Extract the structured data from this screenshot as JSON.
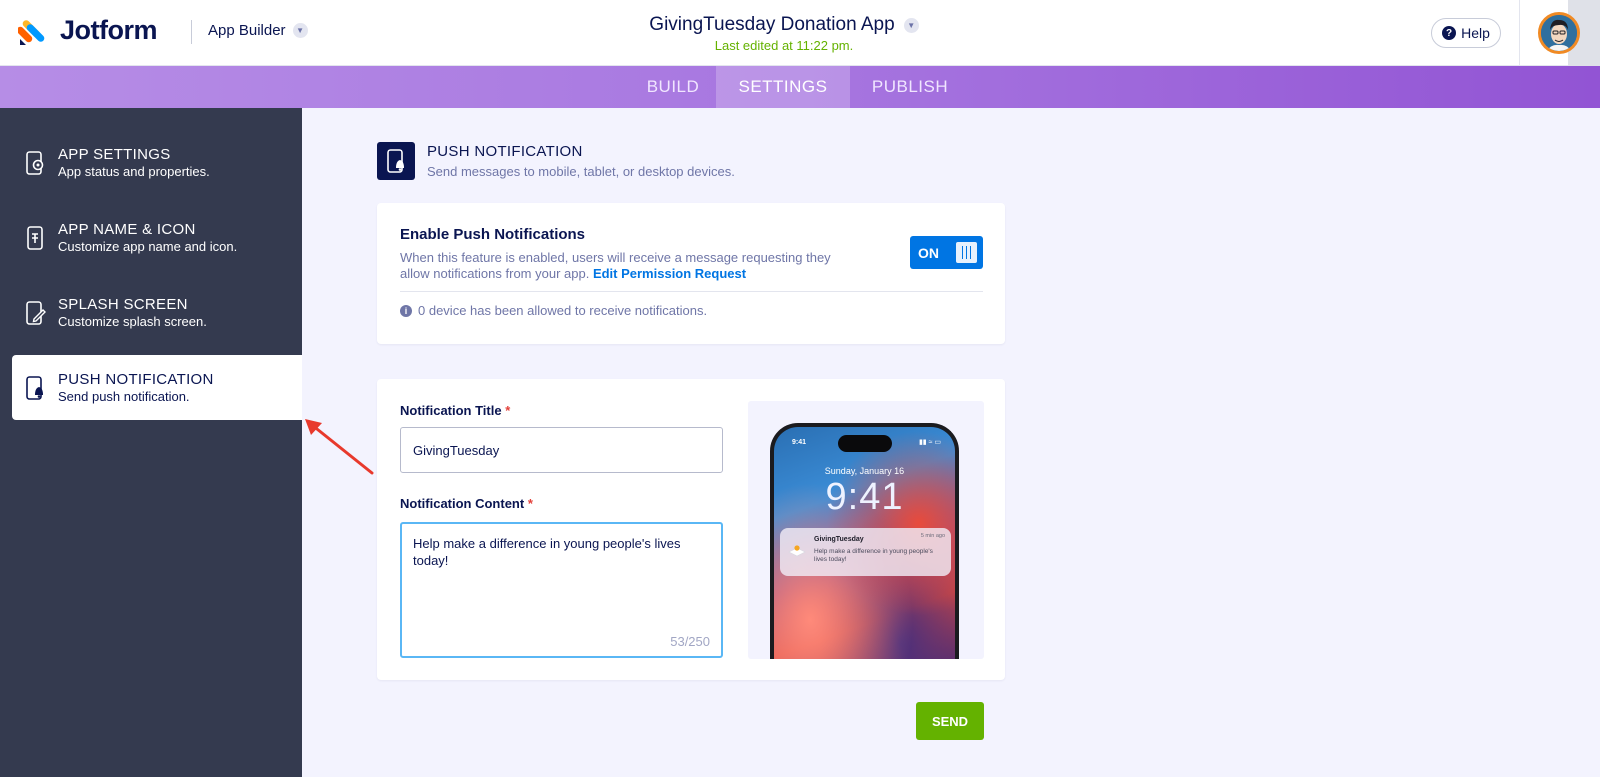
{
  "header": {
    "logo_text": "Jotform",
    "product_label": "App Builder",
    "app_title": "GivingTuesday Donation App",
    "last_edited": "Last edited at 11:22 pm.",
    "help_label": "Help"
  },
  "tabs": [
    {
      "label": "BUILD",
      "active": false
    },
    {
      "label": "SETTINGS",
      "active": true
    },
    {
      "label": "PUBLISH",
      "active": false
    }
  ],
  "sidebar": {
    "items": [
      {
        "title": "APP SETTINGS",
        "desc": "App status and properties.",
        "icon": "gear-phone-icon"
      },
      {
        "title": "APP NAME & ICON",
        "desc": "Customize app name and icon.",
        "icon": "phone-text-icon"
      },
      {
        "title": "SPLASH SCREEN",
        "desc": "Customize splash screen.",
        "icon": "phone-edit-icon"
      },
      {
        "title": "PUSH NOTIFICATION",
        "desc": "Send push notification.",
        "icon": "phone-bell-icon",
        "active": true
      }
    ]
  },
  "section": {
    "title": "PUSH NOTIFICATION",
    "subtitle": "Send messages to mobile, tablet, or desktop devices."
  },
  "enable_card": {
    "title": "Enable Push Notifications",
    "description": "When this feature is enabled, users will receive a message requesting they allow notifications from your app.",
    "link_label": "Edit Permission Request",
    "toggle_label": "ON",
    "toggle_on": true,
    "device_info": "0 device has been allowed to receive notifications."
  },
  "form": {
    "title_label": "Notification Title",
    "title_value": "GivingTuesday",
    "content_label": "Notification Content",
    "required_mark": "*",
    "content_value": "Help make a difference in young people's lives today!",
    "char_count": "53/250"
  },
  "preview": {
    "status_time": "9:41",
    "lock_date": "Sunday, January 16",
    "lock_time": "9:41",
    "notif_title": "GivingTuesday",
    "notif_time": "5 min ago",
    "notif_body": "Help make a difference in young people's lives today!"
  },
  "send_label": "SEND",
  "colors": {
    "accent_blue": "#0075e3",
    "send_green": "#64b200",
    "sidebar_bg": "#343a4f",
    "navy": "#0a1551",
    "tab_purple": "#a776e0",
    "annotation_red": "#e8392c"
  }
}
